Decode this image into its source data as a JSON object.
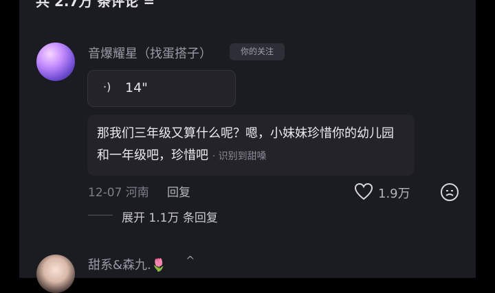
{
  "header": {
    "title": "共 2.7万 条评论 ="
  },
  "comment1": {
    "username": "音爆耀星（找蛋搭子）",
    "follow_badge": "你的关注",
    "voice_duration": "14\"",
    "transcript": "那我们三年级又算什么呢？嗯，小妹妹珍惜你的幼儿园和一年级吧，珍惜吧",
    "recognized_label": "· 识别到甜嗓",
    "date_location": "12-07 河南",
    "reply_label": "回复",
    "like_count": "1.9万",
    "expand_replies": "展开 1.1万 条回复"
  },
  "comment2": {
    "username": "甜系&森九.🌷",
    "caret": "^"
  },
  "icons": {
    "voice": "voice-wave-icon",
    "like": "heart-outline-icon",
    "dislike": "frown-face-icon"
  },
  "colors": {
    "background": "#1b1b22",
    "bubble": "#232329"
  }
}
